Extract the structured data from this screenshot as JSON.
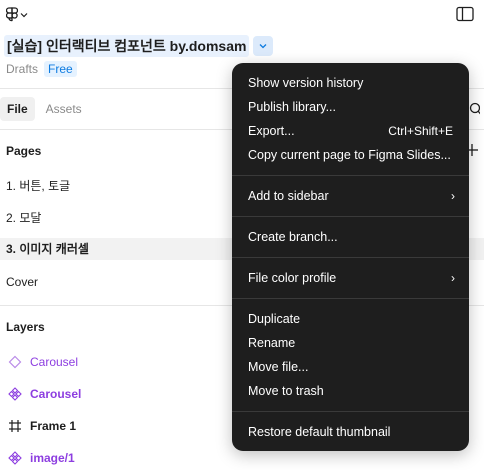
{
  "file": {
    "name": "[실습] 인터랙티브 컴포넌트 by.domsam",
    "location": "Drafts",
    "plan": "Free"
  },
  "tabs": [
    {
      "label": "File"
    },
    {
      "label": "Assets"
    }
  ],
  "pages": {
    "title": "Pages",
    "items": [
      {
        "label": "1. 버튼, 토글"
      },
      {
        "label": "2. 모달"
      },
      {
        "label": "3. 이미지 캐러셀"
      },
      {
        "label": "Cover"
      }
    ]
  },
  "layers": {
    "title": "Layers",
    "items": [
      {
        "label": "Carousel",
        "icon": "component-set-icon"
      },
      {
        "label": "Carousel",
        "icon": "component-icon"
      },
      {
        "label": "Frame 1",
        "icon": "frame-icon"
      },
      {
        "label": "image/1",
        "icon": "component-icon"
      }
    ]
  },
  "menu": {
    "items": [
      {
        "label": "Show version history"
      },
      {
        "label": "Publish library..."
      },
      {
        "label": "Export...",
        "shortcut": "Ctrl+Shift+E"
      },
      {
        "label": "Copy current page to Figma Slides..."
      },
      {
        "label": "Add to sidebar",
        "chevron": "›"
      },
      {
        "label": "Create branch..."
      },
      {
        "label": "File color profile",
        "chevron": "›"
      },
      {
        "label": "Duplicate"
      },
      {
        "label": "Rename"
      },
      {
        "label": "Move file..."
      },
      {
        "label": "Move to trash"
      },
      {
        "label": "Restore default thumbnail"
      }
    ]
  },
  "colors": {
    "menu_bg": "#1e1e1e",
    "accent_blue": "#0d7be0",
    "component_purple": "#8d3ee0"
  }
}
